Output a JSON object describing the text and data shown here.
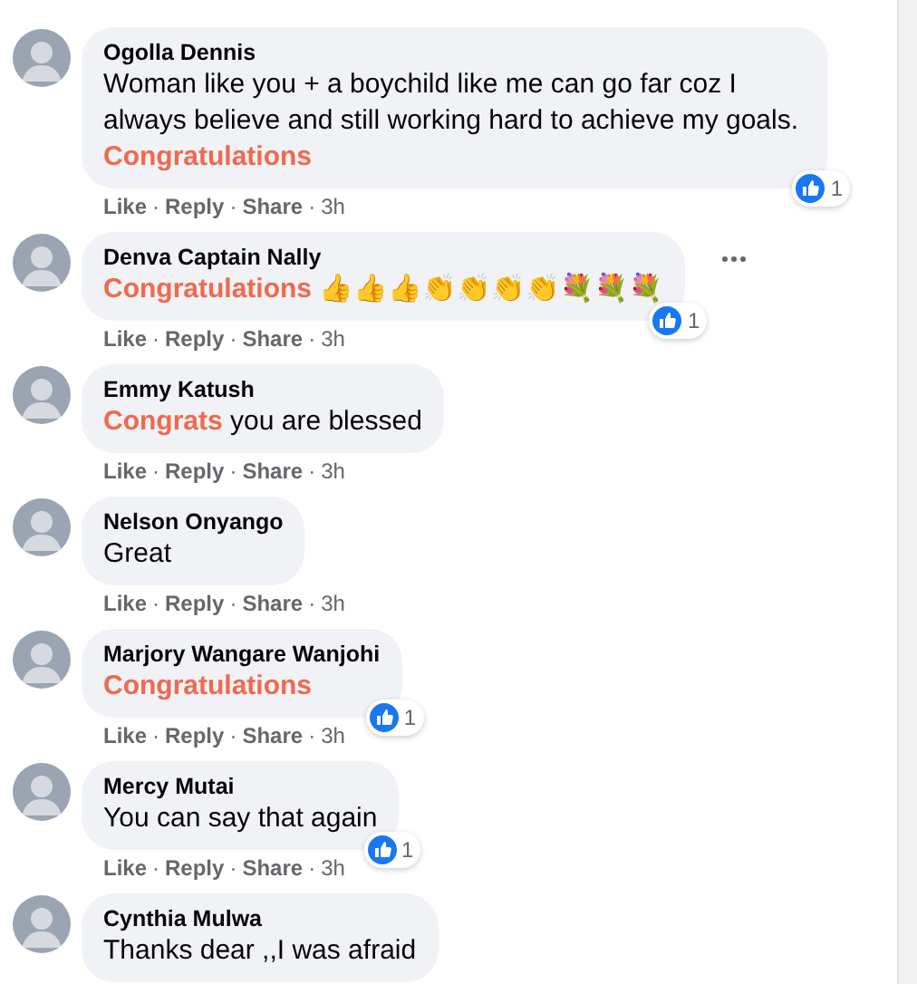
{
  "separator": "·",
  "comments": [
    {
      "author": "Ogolla Dennis",
      "text": "Woman like you + a boychild like me can go far coz I always believe and still working hard to achieve my goals.",
      "highlight": "Congratulations",
      "actions": [
        "Like",
        "Reply",
        "Share",
        "3h"
      ],
      "reaction_count": "1"
    },
    {
      "author": "Denva Captain Nally",
      "text": "**Congratulations** 👍👍👍👏👏👏👏💐💐💐",
      "actions": [
        "Like",
        "Reply",
        "Share",
        "3h"
      ],
      "reaction_count": "1",
      "more_options": true
    },
    {
      "author": "Emmy Katush",
      "text": "**Congrats** you are blessed",
      "actions": [
        "Like",
        "Reply",
        "Share",
        "3h"
      ]
    },
    {
      "author": "Nelson Onyango",
      "text": "Great",
      "actions": [
        "Like",
        "Reply",
        "Share",
        "3h"
      ]
    },
    {
      "author": "Marjory Wangare Wanjohi",
      "text": "**Congratulations**",
      "actions": [
        "Like",
        "Reply",
        "Share",
        "3h"
      ],
      "reaction_count": "1"
    },
    {
      "author": "Mercy Mutai",
      "text": "You can say that again",
      "actions": [
        "Like",
        "Reply",
        "Share",
        "3h"
      ],
      "reaction_count": "1"
    },
    {
      "author": "Cynthia Mulwa",
      "text": "Thanks dear ,,I was afraid"
    }
  ]
}
